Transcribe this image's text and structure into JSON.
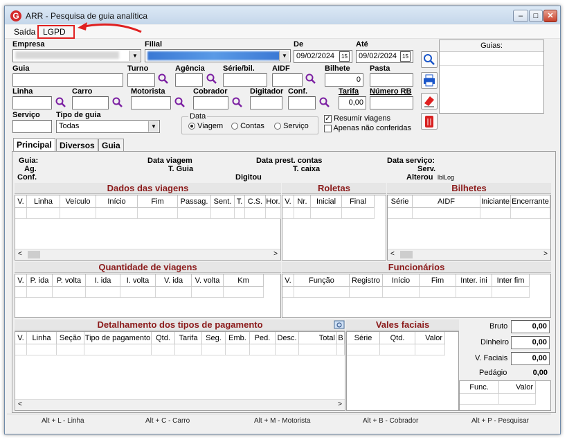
{
  "window": {
    "title": "ARR - Pesquisa de guia analítica",
    "logo": "G",
    "btn_min": "–",
    "btn_max": "□",
    "btn_close": "✕"
  },
  "menu": {
    "saida": "Saída",
    "lgpd": "LGPD"
  },
  "filters": {
    "empresa": {
      "label": "Empresa",
      "value": ""
    },
    "filial": {
      "label": "Filial",
      "value": ""
    },
    "de": {
      "label": "De",
      "value": "09/02/2024"
    },
    "ate": {
      "label": "Até",
      "value": "09/02/2024"
    },
    "guia": "Guia",
    "turno": "Turno",
    "agencia": "Agência",
    "serie": "Série/bil.",
    "aidf": "AIDF",
    "bilhete": {
      "label": "Bilhete",
      "value": "0"
    },
    "pasta": "Pasta",
    "linha": "Linha",
    "carro": "Carro",
    "motorista": "Motorista",
    "cobrador": "Cobrador",
    "digitador": "Digitador",
    "conf": "Conf.",
    "tarifa": {
      "label": "Tarifa",
      "value": "0,00"
    },
    "numero_rb": "Número RB",
    "servico": "Serviço",
    "tipo_guia": {
      "label": "Tipo de guia",
      "value": "Todas"
    },
    "data_group": {
      "label": "Data",
      "options": [
        "Viagem",
        "Contas",
        "Serviço"
      ],
      "selected": "Viagem"
    },
    "resumir": {
      "label": "Resumir viagens",
      "checked": true
    },
    "apenas": {
      "label": "Apenas não conferidas",
      "checked": false
    }
  },
  "guias_panel": {
    "header": "Guias:"
  },
  "tabs": [
    "Principal",
    "Diversos",
    "Guia"
  ],
  "info": {
    "guia": "Guia:",
    "ag": "Ag.",
    "conf": "Conf.",
    "data_viagem": "Data viagem",
    "t_guia": "T. Guia",
    "data_prest": "Data prest. contas",
    "t_caixa": "T. caixa",
    "digitou": "Digitou",
    "data_servico": "Data serviço:",
    "serv": "Serv.",
    "alterou": "Alterou",
    "lbllog": "lblLog"
  },
  "dados_viagens": {
    "title": "Dados das viagens",
    "columns": [
      "V.",
      "Linha",
      "Veículo",
      "Início",
      "Fim",
      "Passag.",
      "Sent.",
      "T.",
      "C.S.",
      "Hor."
    ]
  },
  "roletas": {
    "title": "Roletas",
    "columns": [
      "V.",
      "Nr.",
      "Inicial",
      "Final"
    ]
  },
  "bilhetes": {
    "title": "Bilhetes",
    "columns": [
      "Série",
      "AIDF",
      "Iniciante",
      "Encerrante"
    ]
  },
  "qtd_viagens": {
    "title": "Quantidade de viagens",
    "columns": [
      "V.",
      "P. ida",
      "P. volta",
      "I. ida",
      "I. volta",
      "V. ida",
      "V. volta",
      "Km"
    ]
  },
  "funcionarios": {
    "title": "Funcionários",
    "columns": [
      "V.",
      "Função",
      "Registro",
      "Início",
      "Fim",
      "Inter. ini",
      "Inter fim"
    ]
  },
  "pagamento": {
    "title": "Detalhamento dos tipos de pagamento",
    "columns": [
      "V.",
      "Linha",
      "Seção",
      "Tipo de pagamento",
      "Qtd.",
      "Tarifa",
      "Seg.",
      "Emb.",
      "Ped.",
      "Desc.",
      "Total",
      "B"
    ]
  },
  "vales": {
    "title": "Vales faciais",
    "columns": [
      "Série",
      "Qtd.",
      "Valor"
    ]
  },
  "totais": {
    "bruto": {
      "label": "Bruto",
      "value": "0,00"
    },
    "dinheiro": {
      "label": "Dinheiro",
      "value": "0,00"
    },
    "faciais": {
      "label": "V. Faciais",
      "value": "0,00"
    },
    "pedagio": {
      "label": "Pedágio",
      "value": "0,00"
    },
    "func_cols": [
      "Func.",
      "Valor"
    ]
  },
  "status": [
    "Alt + L - Linha",
    "Alt + C - Carro",
    "Alt + M - Motorista",
    "Alt + B - Cobrador",
    "Alt + P - Pesquisar"
  ],
  "colors": {
    "accent": "#8b1a1a",
    "highlight": "#e02020",
    "search_icon": "#7b1fa2"
  }
}
